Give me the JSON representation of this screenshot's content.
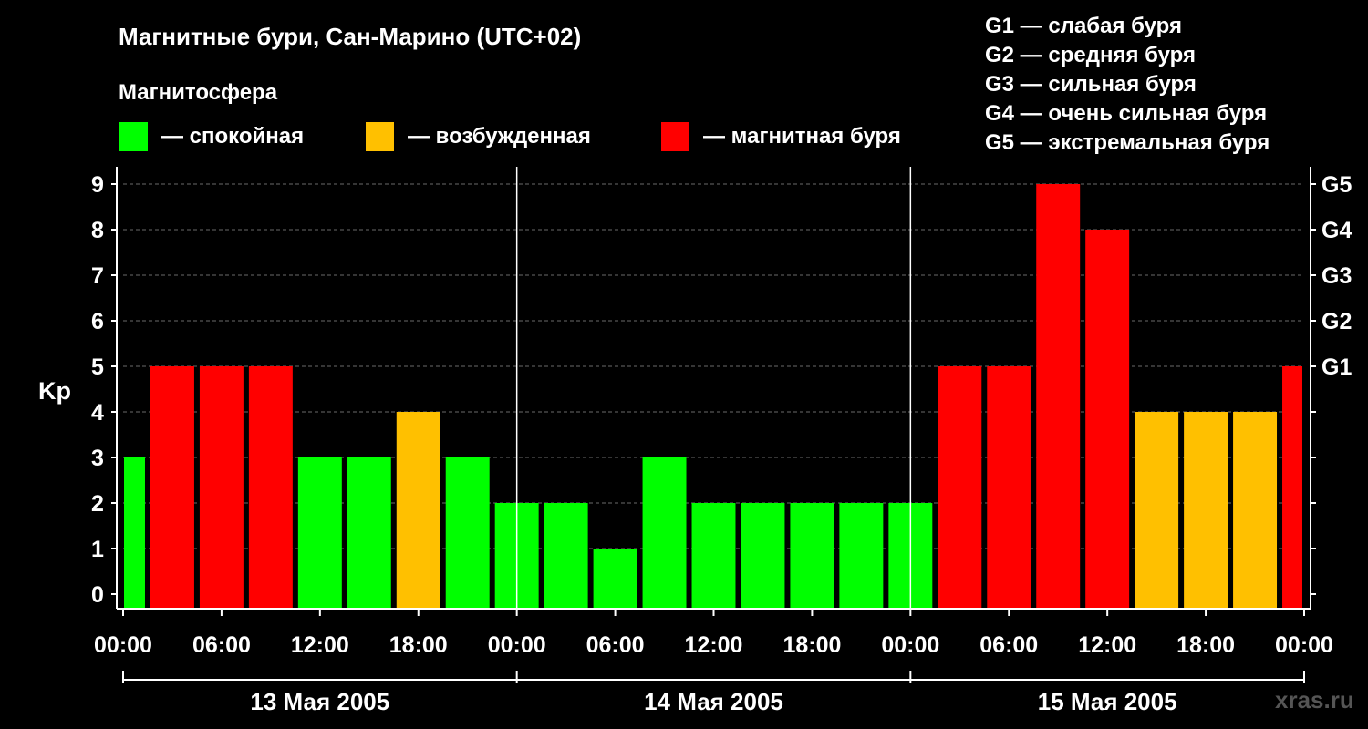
{
  "chart_data": {
    "type": "bar",
    "title": "Магнитные бури, Сан-Марино (UTC+02)",
    "legend_title": "Магнитосфера",
    "legend": [
      {
        "label": "— спокойная",
        "color": "#00ff00"
      },
      {
        "label": "— возбужденная",
        "color": "#ffc000"
      },
      {
        "label": "— магнитная буря",
        "color": "#ff0000"
      }
    ],
    "g_scale_legend": [
      "G1 — слабая буря",
      "G2 — средняя буря",
      "G3 — сильная буря",
      "G4 — очень сильная буря",
      "G5 — экстремальная буря"
    ],
    "ylabel": "Kp",
    "ylim": [
      0,
      9
    ],
    "y_ticks": [
      "0",
      "1",
      "2",
      "3",
      "4",
      "5",
      "6",
      "7",
      "8",
      "9"
    ],
    "right_ticks": [
      {
        "value": 5,
        "label": "G1"
      },
      {
        "value": 6,
        "label": "G2"
      },
      {
        "value": 7,
        "label": "G3"
      },
      {
        "value": 8,
        "label": "G4"
      },
      {
        "value": 9,
        "label": "G5"
      }
    ],
    "x_tick_labels": [
      "00:00",
      "06:00",
      "12:00",
      "18:00",
      "00:00",
      "06:00",
      "12:00",
      "18:00",
      "00:00",
      "06:00",
      "12:00",
      "18:00",
      "00:00"
    ],
    "days": [
      "13 Мая 2005",
      "14 Мая 2005",
      "15 Мая 2005"
    ],
    "interval_hours": 3,
    "values": [
      3,
      5,
      5,
      5,
      3,
      3,
      4,
      3,
      2,
      2,
      1,
      3,
      2,
      2,
      2,
      2,
      2,
      5,
      5,
      9,
      8,
      4,
      4,
      4,
      5
    ],
    "colors": {
      "quiet": "#00ff00",
      "unsettled": "#ffc000",
      "storm": "#ff0000"
    },
    "grid_lines": "dashed at each integer Kp",
    "watermark": "xras.ru"
  }
}
